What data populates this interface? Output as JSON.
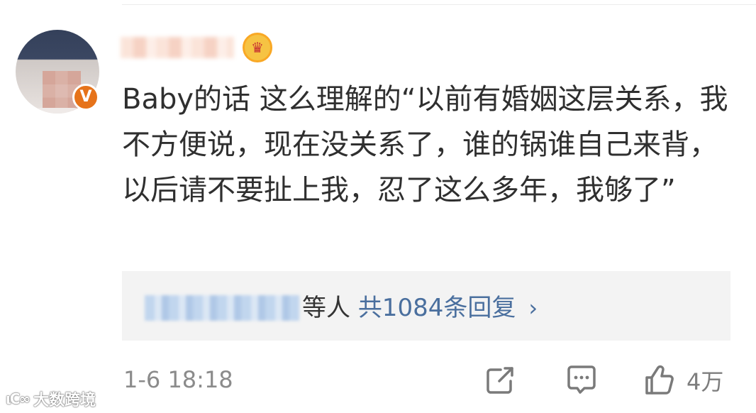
{
  "comment": {
    "text": "Baby的话 这么理解的“以前有婚姻这层关系，我不方便说，现在没关系了，谁的锅谁自己来背，以后请不要扯上我，忍了这么多年，我够了”"
  },
  "user": {
    "verified_badge": "V",
    "vip_icon": "crown-icon"
  },
  "reply": {
    "suffix": "等人",
    "count_label": "共1084条回复",
    "chevron": "›"
  },
  "footer": {
    "timestamp": "1-6 18:18",
    "like_count": "4万",
    "share_icon": "share-icon",
    "comment_icon": "comment-icon",
    "like_icon": "thumbs-up-icon"
  },
  "watermark": {
    "logo": "ιC∞",
    "text": "大数跨境"
  },
  "colors": {
    "link": "#4a6f9e",
    "verified": "#e6731a",
    "vip": "#f6c343"
  }
}
